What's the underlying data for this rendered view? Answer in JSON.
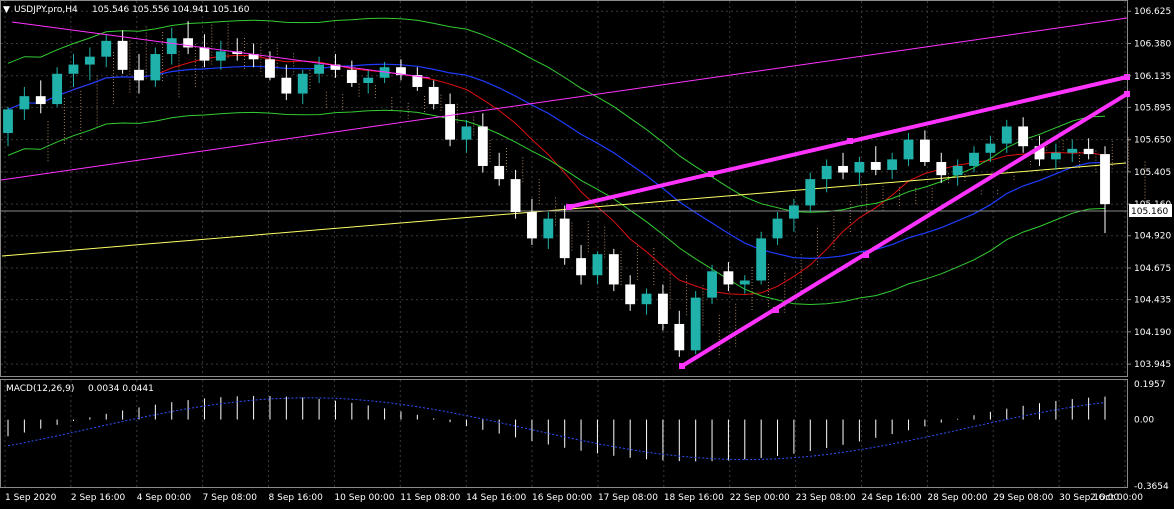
{
  "header": {
    "symbol": "USDJPY.pro,H4",
    "ohlc": "105.546 105.556 104.941 105.160"
  },
  "macd_header": {
    "name": "MACD(12,26,9)",
    "values": "0.0034 0.0441"
  },
  "price_axis": {
    "ticks": [
      "106.625",
      "106.380",
      "106.135",
      "105.895",
      "105.650",
      "105.405",
      "105.160",
      "104.920",
      "104.675",
      "104.435",
      "104.190",
      "103.945"
    ],
    "current_price": "105.160"
  },
  "macd_axis": {
    "ticks": [
      "0.1957",
      "0.00",
      "-0.3654"
    ]
  },
  "time_axis": {
    "labels": [
      "1 Sep 2020",
      "2 Sep 16:00",
      "4 Sep 00:00",
      "7 Sep 08:00",
      "8 Sep 16:00",
      "10 Sep 00:00",
      "11 Sep 08:00",
      "14 Sep 16:00",
      "16 Sep 00:00",
      "17 Sep 08:00",
      "18 Sep 16:00",
      "22 Sep 00:00",
      "23 Sep 08:00",
      "24 Sep 16:00",
      "28 Sep 00:00",
      "29 Sep 08:00",
      "30 Sep 16:00",
      "2 Oct 00:00"
    ]
  },
  "colors": {
    "background": "#000000",
    "grid": "#3a3a3a",
    "bull_candle": "#20b2aa",
    "bear_candle": "#ffffff",
    "trendline": "#ff33ff",
    "ma_blue": "#1e3cff",
    "ma_red": "#e01010",
    "bollinger": "#33cc33",
    "yellow_line": "#ffff66",
    "cloud": "#d2a679",
    "macd_hist": "#ffffff",
    "macd_signal": "#3050ff"
  },
  "chart_data": {
    "type": "candlestick",
    "symbol": "USDJPY.pro",
    "timeframe": "H4",
    "ylim": [
      103.87,
      106.68
    ],
    "candles": [
      [
        105.7,
        105.9,
        105.6,
        105.88
      ],
      [
        105.88,
        106.05,
        105.8,
        105.98
      ],
      [
        105.98,
        106.1,
        105.85,
        105.92
      ],
      [
        105.92,
        106.2,
        105.9,
        106.15
      ],
      [
        106.15,
        106.3,
        106.05,
        106.22
      ],
      [
        106.22,
        106.35,
        106.1,
        106.28
      ],
      [
        106.28,
        106.45,
        106.2,
        106.4
      ],
      [
        106.4,
        106.48,
        106.15,
        106.18
      ],
      [
        106.18,
        106.3,
        106.0,
        106.1
      ],
      [
        106.1,
        106.35,
        106.05,
        106.3
      ],
      [
        106.3,
        106.5,
        106.22,
        106.42
      ],
      [
        106.42,
        106.55,
        106.3,
        106.35
      ],
      [
        106.35,
        106.45,
        106.2,
        106.25
      ],
      [
        106.25,
        106.4,
        106.18,
        106.32
      ],
      [
        106.32,
        106.42,
        106.25,
        106.3
      ],
      [
        106.3,
        106.38,
        106.2,
        106.26
      ],
      [
        106.26,
        106.32,
        106.1,
        106.12
      ],
      [
        106.12,
        106.22,
        105.95,
        106.0
      ],
      [
        106.0,
        106.18,
        105.92,
        106.15
      ],
      [
        106.15,
        106.28,
        106.08,
        106.22
      ],
      [
        106.22,
        106.3,
        106.12,
        106.18
      ],
      [
        106.18,
        106.25,
        106.05,
        106.08
      ],
      [
        106.08,
        106.18,
        106.0,
        106.12
      ],
      [
        106.12,
        106.24,
        106.08,
        106.2
      ],
      [
        106.2,
        106.26,
        106.1,
        106.14
      ],
      [
        106.14,
        106.2,
        106.02,
        106.05
      ],
      [
        106.05,
        106.1,
        105.88,
        105.92
      ],
      [
        105.92,
        106.0,
        105.6,
        105.65
      ],
      [
        105.65,
        105.8,
        105.55,
        105.75
      ],
      [
        105.75,
        105.85,
        105.4,
        105.45
      ],
      [
        105.45,
        105.55,
        105.3,
        105.35
      ],
      [
        105.35,
        105.42,
        105.05,
        105.1
      ],
      [
        105.1,
        105.2,
        104.85,
        104.9
      ],
      [
        104.9,
        105.1,
        104.82,
        105.05
      ],
      [
        105.05,
        105.15,
        104.7,
        104.75
      ],
      [
        104.75,
        104.85,
        104.55,
        104.62
      ],
      [
        104.62,
        104.8,
        104.55,
        104.78
      ],
      [
        104.78,
        104.82,
        104.5,
        104.55
      ],
      [
        104.55,
        104.62,
        104.35,
        104.4
      ],
      [
        104.4,
        104.52,
        104.32,
        104.48
      ],
      [
        104.48,
        104.55,
        104.2,
        104.25
      ],
      [
        104.25,
        104.35,
        104.0,
        104.05
      ],
      [
        104.05,
        104.5,
        104.02,
        104.45
      ],
      [
        104.45,
        104.7,
        104.4,
        104.65
      ],
      [
        104.65,
        104.72,
        104.5,
        104.55
      ],
      [
        104.55,
        104.62,
        104.48,
        104.58
      ],
      [
        104.58,
        104.95,
        104.55,
        104.9
      ],
      [
        104.9,
        105.1,
        104.85,
        105.05
      ],
      [
        105.05,
        105.2,
        104.95,
        105.15
      ],
      [
        105.15,
        105.4,
        105.1,
        105.35
      ],
      [
        105.35,
        105.5,
        105.25,
        105.45
      ],
      [
        105.45,
        105.55,
        105.35,
        105.4
      ],
      [
        105.4,
        105.52,
        105.3,
        105.48
      ],
      [
        105.48,
        105.6,
        105.38,
        105.42
      ],
      [
        105.42,
        105.55,
        105.35,
        105.5
      ],
      [
        105.5,
        105.7,
        105.45,
        105.65
      ],
      [
        105.65,
        105.72,
        105.45,
        105.48
      ],
      [
        105.48,
        105.55,
        105.32,
        105.38
      ],
      [
        105.38,
        105.5,
        105.3,
        105.45
      ],
      [
        105.45,
        105.6,
        105.4,
        105.55
      ],
      [
        105.55,
        105.68,
        105.48,
        105.62
      ],
      [
        105.62,
        105.8,
        105.55,
        105.75
      ],
      [
        105.75,
        105.82,
        105.55,
        105.6
      ],
      [
        105.6,
        105.68,
        105.45,
        105.5
      ],
      [
        105.5,
        105.62,
        105.42,
        105.55
      ],
      [
        105.55,
        105.65,
        105.48,
        105.58
      ],
      [
        105.58,
        105.66,
        105.5,
        105.54
      ],
      [
        105.54,
        105.6,
        104.94,
        105.16
      ]
    ],
    "trendlines": [
      {
        "name": "upper-channel",
        "from": [
          "17 Sep 08:00",
          105.18
        ],
        "to": [
          "2 Oct 00:00",
          106.15
        ]
      },
      {
        "name": "lower-channel",
        "from": [
          "18 Sep 16:00",
          103.96
        ],
        "to": [
          "2 Oct 00:00",
          106.03
        ]
      }
    ],
    "macd": {
      "name": "MACD(12,26,9)",
      "ylim": [
        -0.3654,
        0.1957
      ]
    }
  }
}
